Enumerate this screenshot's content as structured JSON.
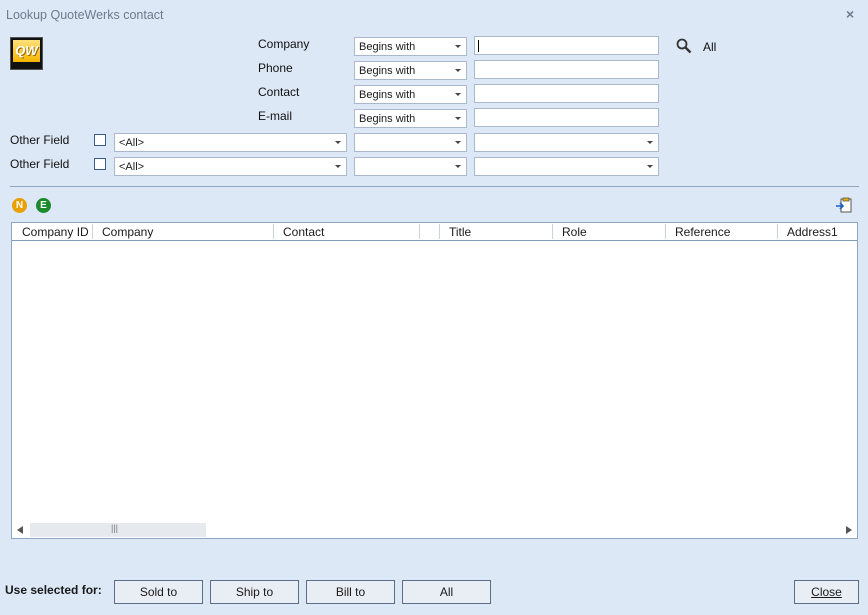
{
  "window": {
    "title": "Lookup QuoteWerks contact",
    "close_glyph": "×"
  },
  "logo": {
    "text": "QW"
  },
  "search": {
    "fields": [
      {
        "label": "Company",
        "operator": "Begins with",
        "value": ""
      },
      {
        "label": "Phone",
        "operator": "Begins with",
        "value": ""
      },
      {
        "label": "Contact",
        "operator": "Begins with",
        "value": ""
      },
      {
        "label": "E-mail",
        "operator": "Begins with",
        "value": ""
      }
    ],
    "other_fields": [
      {
        "label": "Other Field",
        "field": "<All>",
        "operator": "",
        "value": ""
      },
      {
        "label": "Other Field",
        "field": "<All>",
        "operator": "",
        "value": ""
      }
    ],
    "all_label": "All"
  },
  "toolbar": {
    "n_label": "N",
    "e_label": "E"
  },
  "grid": {
    "columns": [
      "Company ID",
      "Company",
      "Contact",
      "",
      "Title",
      "Role",
      "Reference",
      "Address1"
    ],
    "rows": [],
    "scroll_thumb": "|||"
  },
  "footer": {
    "use_selected_label": "Use selected for:",
    "buttons": [
      "Sold to",
      "Ship to",
      "Bill to",
      "All"
    ],
    "close_label": "Close"
  },
  "colors": {
    "background": "#dde8f6",
    "border": "#8fa5c0",
    "n_icon": "#e8a000",
    "e_icon": "#1a8a2a"
  }
}
